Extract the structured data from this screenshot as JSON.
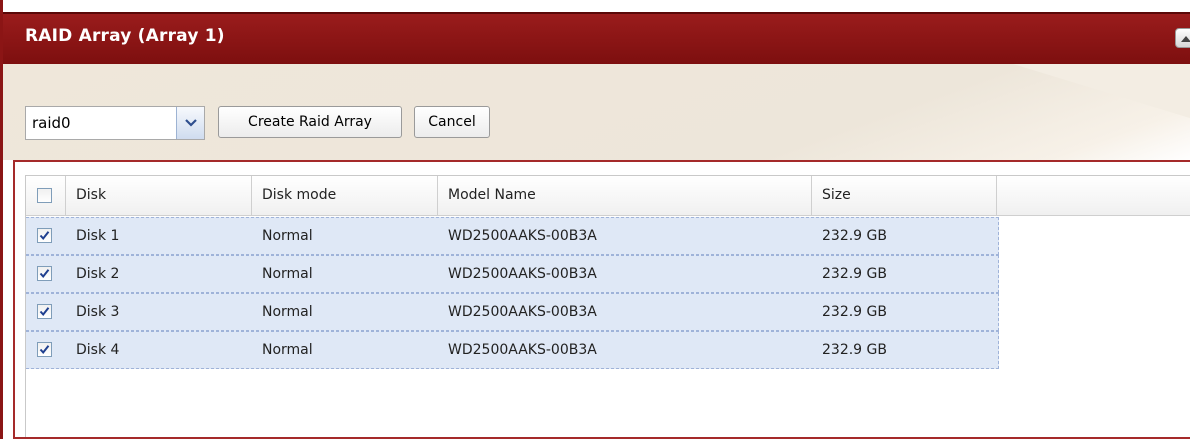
{
  "panel": {
    "title": "RAID Array (Array 1)"
  },
  "toolbar": {
    "raid_level": "raid0",
    "create_label": "Create Raid Array",
    "cancel_label": "Cancel"
  },
  "grid": {
    "columns": [
      "Disk",
      "Disk mode",
      "Model Name",
      "Size"
    ],
    "select_all_checked": false,
    "rows": [
      {
        "disk": "Disk 1",
        "mode": "Normal",
        "model": "WD2500AAKS-00B3A",
        "size": "232.9 GB",
        "checked": true
      },
      {
        "disk": "Disk 2",
        "mode": "Normal",
        "model": "WD2500AAKS-00B3A",
        "size": "232.9 GB",
        "checked": true
      },
      {
        "disk": "Disk 3",
        "mode": "Normal",
        "model": "WD2500AAKS-00B3A",
        "size": "232.9 GB",
        "checked": true
      },
      {
        "disk": "Disk 4",
        "mode": "Normal",
        "model": "WD2500AAKS-00B3A",
        "size": "232.9 GB",
        "checked": true
      }
    ]
  },
  "icons": {
    "collapse": "chevron-up-icon",
    "dropdown": "chevron-down-icon",
    "check": "check-icon"
  },
  "colors": {
    "titlebar": "#8b1515",
    "row_selected": "#dfe8f6",
    "check_mark": "#1f3f8f"
  }
}
